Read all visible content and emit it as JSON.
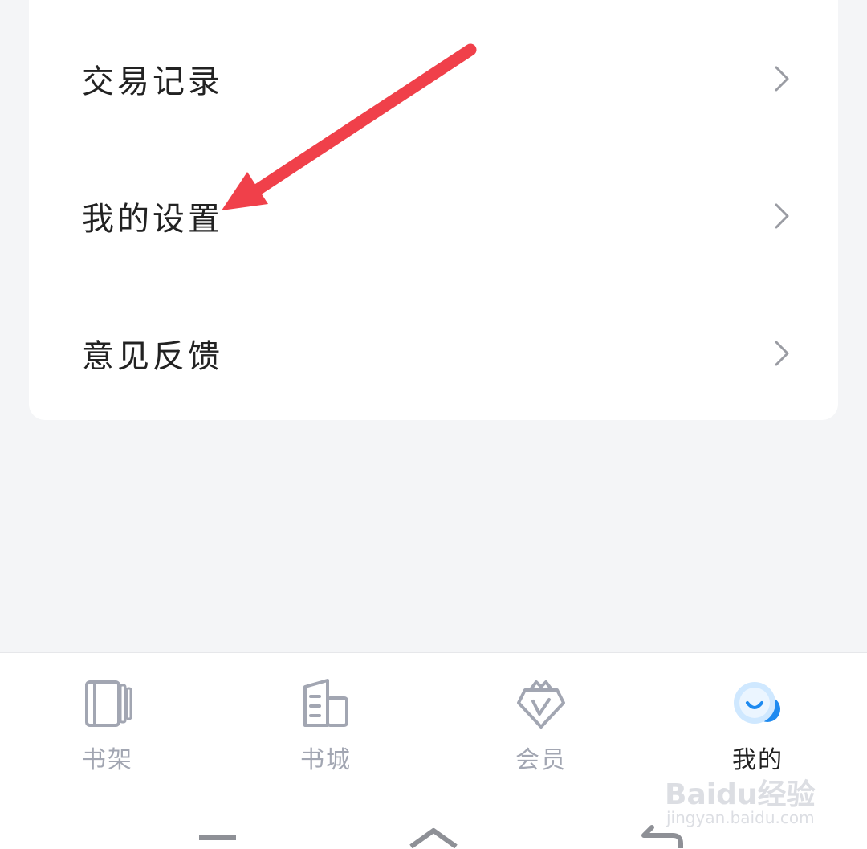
{
  "menu": {
    "items": [
      {
        "label": "交易记录",
        "icon": "chevron-right-icon"
      },
      {
        "label": "我的设置",
        "icon": "chevron-right-icon"
      },
      {
        "label": "意见反馈",
        "icon": "chevron-right-icon"
      }
    ]
  },
  "annotation": {
    "arrow_color": "#f0404a"
  },
  "tabbar": {
    "active_index": 3,
    "active_color": "#222222",
    "inactive_color": "#a2a6b2",
    "tabs": [
      {
        "label": "书架",
        "icon": "bookshelf-icon"
      },
      {
        "label": "书城",
        "icon": "bookstore-icon"
      },
      {
        "label": "会员",
        "icon": "vip-crown-icon"
      },
      {
        "label": "我的",
        "icon": "profile-bubble-icon"
      }
    ]
  },
  "watermark": {
    "main": "Baidu经验",
    "sub": "jingyan.baidu.com"
  },
  "system_nav": {
    "buttons": [
      "menu-icon",
      "home-icon",
      "back-icon"
    ]
  }
}
